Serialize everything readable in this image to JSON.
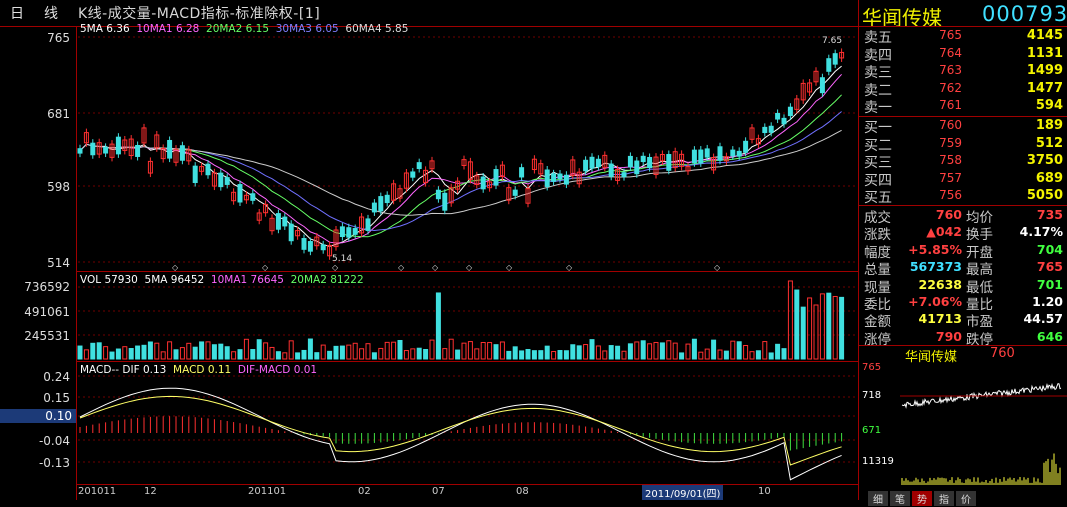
{
  "topbar": {
    "period_day": "日",
    "period_line": "线",
    "title": "K线-成交量-MACD指标-标准除权-[1]"
  },
  "stock": {
    "name": "华闻传媒",
    "code": "000793"
  },
  "kline": {
    "yaxis": [
      "765",
      "681",
      "598",
      "514"
    ],
    "legend": [
      {
        "text": "5MA 6.36",
        "color": "#ffffff"
      },
      {
        "text": "10MA1 6.28",
        "color": "#ff66ff"
      },
      {
        "text": "20MA2 6.15",
        "color": "#66ff66"
      },
      {
        "text": "30MA3 6.05",
        "color": "#7070ff"
      },
      {
        "text": "60MA4 5.85",
        "color": "#dddddd"
      }
    ],
    "high_marker": "7.65",
    "low_marker": "5.14"
  },
  "volume": {
    "yaxis": [
      "736592",
      "491061",
      "245531"
    ],
    "legend": [
      {
        "text": "VOL 57930",
        "color": "#ffffff"
      },
      {
        "text": "5MA 96452",
        "color": "#ffffff"
      },
      {
        "text": "10MA1 76645",
        "color": "#ff66ff"
      },
      {
        "text": "20MA2 81222",
        "color": "#66ff66"
      }
    ]
  },
  "macd": {
    "yaxis": [
      "0.24",
      "0.15",
      "0.10",
      "-0.04",
      "-0.13"
    ],
    "highlight_value": "0.10",
    "legend": [
      {
        "text": "MACD-- DIF 0.13",
        "color": "#ffffff"
      },
      {
        "text": "MACD 0.11",
        "color": "#ffff66"
      },
      {
        "text": "DIF-MACD 0.01",
        "color": "#ff66ff"
      }
    ]
  },
  "xaxis": {
    "labels": [
      "201011",
      "12",
      "201101",
      "02",
      "07",
      "08",
      "10"
    ],
    "cursor_date": "2011/09/01(四)"
  },
  "orderbook": {
    "sell": [
      {
        "label": "卖五",
        "price": "765",
        "vol": "4145"
      },
      {
        "label": "卖四",
        "price": "764",
        "vol": "1131"
      },
      {
        "label": "卖三",
        "price": "763",
        "vol": "1499"
      },
      {
        "label": "卖二",
        "price": "762",
        "vol": "1477"
      },
      {
        "label": "卖一",
        "price": "761",
        "vol": "594"
      }
    ],
    "buy": [
      {
        "label": "买一",
        "price": "760",
        "vol": "189"
      },
      {
        "label": "买二",
        "price": "759",
        "vol": "512"
      },
      {
        "label": "买三",
        "price": "758",
        "vol": "3750"
      },
      {
        "label": "买四",
        "price": "757",
        "vol": "689"
      },
      {
        "label": "买五",
        "price": "756",
        "vol": "5050"
      }
    ]
  },
  "quote": [
    {
      "l1": "成交",
      "v1": "760",
      "c1": "#ff4040",
      "l2": "均价",
      "v2": "735",
      "c2": "#ff4040"
    },
    {
      "l1": "涨跌",
      "v1": "▲042",
      "c1": "#ff4040",
      "l2": "换手",
      "v2": "4.17%",
      "c2": "#ffffff"
    },
    {
      "l1": "幅度",
      "v1": "+5.85%",
      "c1": "#ff4040",
      "l2": "开盘",
      "v2": "704",
      "c2": "#40ff40"
    },
    {
      "l1": "总量",
      "v1": "567373",
      "c1": "#40e0ff",
      "l2": "最高",
      "v2": "765",
      "c2": "#ff4040"
    },
    {
      "l1": "现量",
      "v1": "22638",
      "c1": "#ffff40",
      "l2": "最低",
      "v2": "701",
      "c2": "#40ff40"
    },
    {
      "l1": "委比",
      "v1": "+7.06%",
      "c1": "#ff4040",
      "l2": "量比",
      "v2": "1.20",
      "c2": "#ffffff"
    },
    {
      "l1": "金额",
      "v1": "41713",
      "c1": "#ffff40",
      "l2": "市盈",
      "v2": "44.57",
      "c2": "#ffffff"
    },
    {
      "l1": "涨停",
      "v1": "790",
      "c1": "#ff4040",
      "l2": "跌停",
      "v2": "646",
      "c2": "#40ff40"
    }
  ],
  "mini": {
    "name": "华闻传媒",
    "price": "760",
    "yaxis": [
      "765",
      "718",
      "671"
    ],
    "vol_label": "11319"
  },
  "bottom_tabs": [
    "细",
    "笔",
    "势",
    "指",
    "价"
  ],
  "active_tab": "势",
  "colors": {
    "up": "#ff3030",
    "down": "#40e0e0",
    "grid": "#a00000",
    "title_yellow": "#f0f000",
    "code_cyan": "#40e0ff"
  }
}
